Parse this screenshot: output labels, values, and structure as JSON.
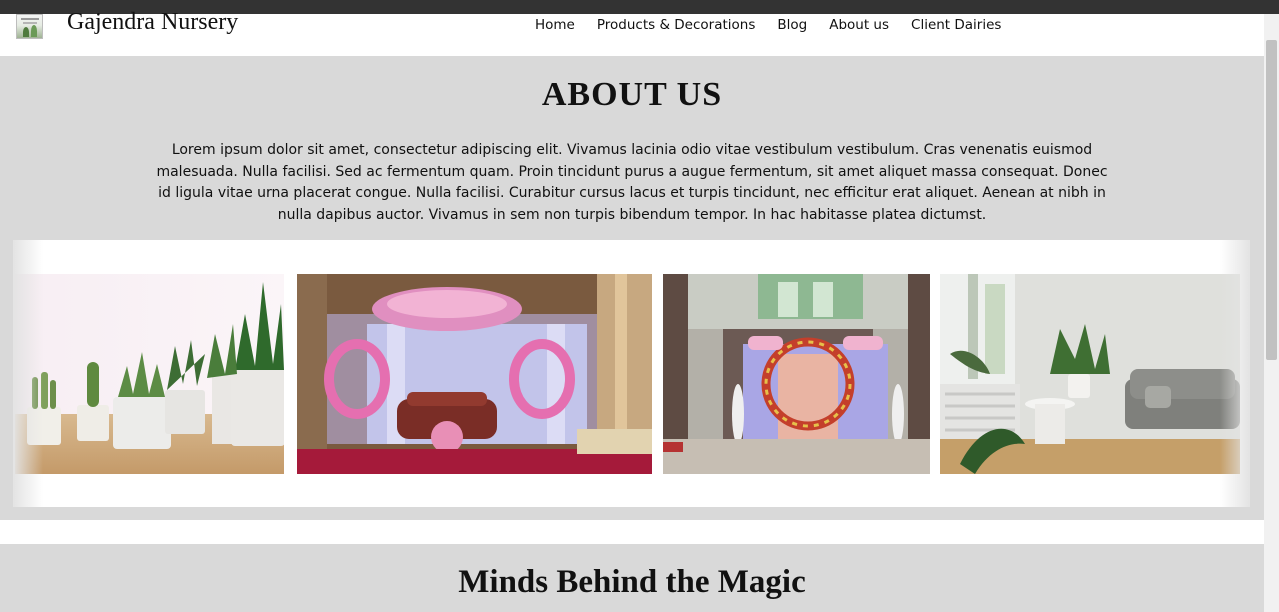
{
  "header": {
    "brand": "Gajendra Nursery",
    "nav": [
      "Home",
      "Products & Decorations",
      "Blog",
      "About us",
      "Client Dairies"
    ]
  },
  "about": {
    "heading": "ABOUT US",
    "body": "Lorem ipsum dolor sit amet, consectetur adipiscing elit. Vivamus lacinia odio vitae vestibulum vestibulum. Cras venenatis euismod malesuada. Nulla facilisi. Sed ac fermentum quam. Proin tincidunt purus a augue fermentum, sit amet aliquet massa consequat. Donec id ligula vitae urna placerat congue. Nulla facilisi. Curabitur cursus lacus et turpis tincidunt, nec efficitur erat aliquet. Aenean at nibh in nulla dapibus auctor. Vivamus in sem non turpis bibendum tempor. In hac habitasse platea dictumst.",
    "gallery": [
      "potted-succulents-photo",
      "floral-stage-decoration-photo",
      "floral-arch-entrance-photo",
      "living-room-plants-photo"
    ]
  },
  "team": {
    "heading": "Minds Behind the Magic"
  },
  "colors": {
    "section_bg": "#d9d9d9",
    "topbar": "#333333",
    "text": "#111111"
  }
}
